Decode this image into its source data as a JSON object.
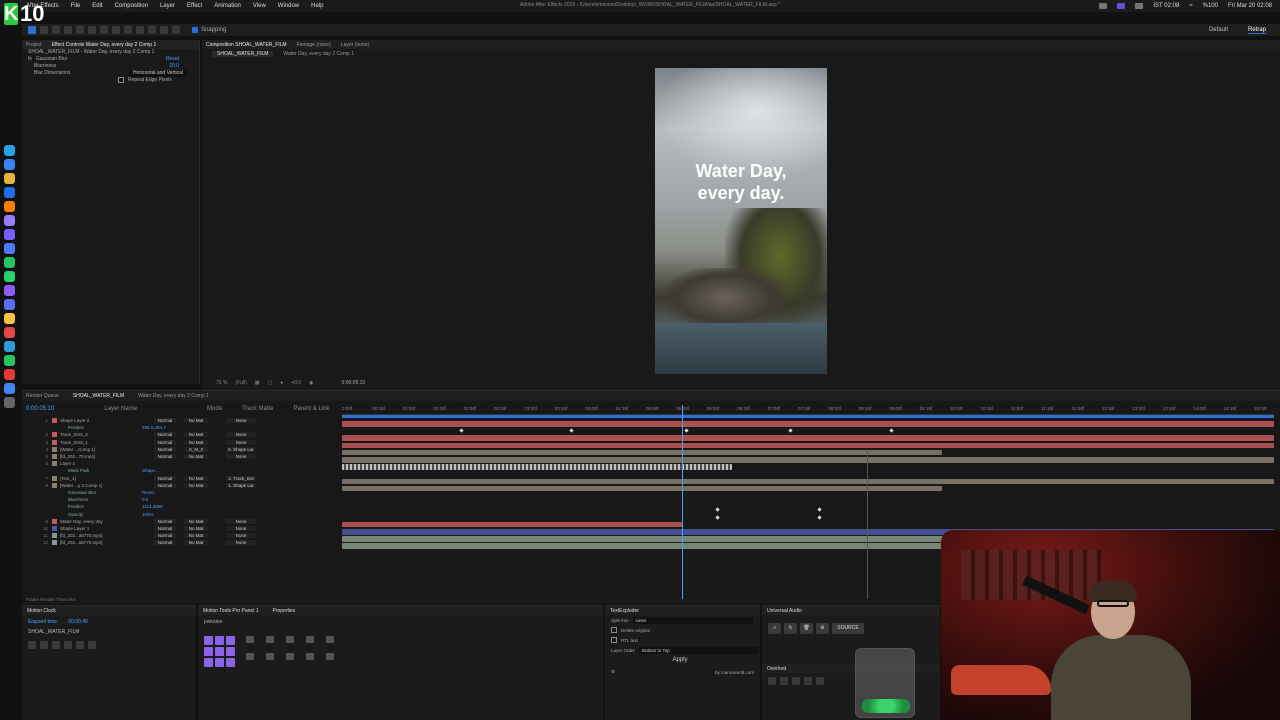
{
  "menubar": {
    "menus": [
      "After Effects",
      "File",
      "Edit",
      "Composition",
      "Layer",
      "Effect",
      "Animation",
      "View",
      "Window",
      "Help"
    ],
    "app_title": "Adobe After Effects 2026 - /Users/emerson/Desktop/_WORK/SHOAL_WATER_FILM/ae/SHOAL_WATER_FILM.aep *",
    "clock": "IST 02:08",
    "wifi": "%100",
    "date": "Fri Mar 20 02:08"
  },
  "logo": {
    "letter": "K",
    "number": "10"
  },
  "toolbar": {
    "snapping": "Snapping",
    "workspaces": [
      "Default",
      "Retrap"
    ]
  },
  "left_panel": {
    "tabs": [
      "Project",
      "Effect Controls Water Day, every day 2 Comp 1"
    ],
    "comp_label": "SHOAL_WATER_FILM - Water Day, every day 2 Comp 1",
    "effect_name": "Gaussian Blur",
    "effect_reset": "Reset",
    "rows": [
      {
        "label": "Blurriness",
        "value": "20.0"
      },
      {
        "label": "Blur Dimensions",
        "value": "Horizontal and Vertical"
      },
      {
        "label": "Repeat Edge Pixels",
        "value": ""
      }
    ]
  },
  "viewer": {
    "tabs": [
      "Composition SHOAL_WATER_FILM",
      "Footage (none)",
      "Layer (none)"
    ],
    "crumbs": [
      "SHOAL_WATER_FILM",
      "Water Day, every day 2 Comp 1"
    ],
    "title_line1": "Water Day,",
    "title_line2": "every day.",
    "zoom": "75 %",
    "resolution": "(Full)",
    "timecode": "0:00:05:10",
    "exposure": "+0.0"
  },
  "timeline": {
    "tabs": [
      "Render Queue",
      "SHOAL_WATER_FILM",
      "Water Day, every day 2 Comp 1"
    ],
    "timecode": "0:00:05:10",
    "col_headers": [
      "Layer Name",
      "Mode",
      "Track Matte",
      "Parent & Link"
    ],
    "ruler": [
      "0:00f",
      "00:15f",
      "01:00f",
      "01:15f",
      "02:00f",
      "02:15f",
      "03:00f",
      "03:15f",
      "04:00f",
      "04:15f",
      "05:00f",
      "05:15f",
      "06:00f",
      "06:15f",
      "07:00f",
      "07:15f",
      "08:00f",
      "08:15f",
      "09:00f",
      "09:15f",
      "10:00f",
      "10:15f",
      "11:00f",
      "11:15f",
      "12:00f",
      "12:15f",
      "13:00f",
      "13:15f",
      "14:00f",
      "14:15f",
      "15:00f"
    ],
    "layers": [
      {
        "idx": "1",
        "name": "Shape Layer 2",
        "mode": "Normal",
        "matte": "No Mat",
        "parent": "None",
        "color": "#c45a5a",
        "sub": false
      },
      {
        "idx": "",
        "name": "Position",
        "value": "288.0,484.7",
        "sub": true
      },
      {
        "idx": "2",
        "name": "Track_Dots_2",
        "mode": "Normal",
        "matte": "No Mat",
        "parent": "None",
        "color": "#c45a5a",
        "sub": false
      },
      {
        "idx": "3",
        "name": "Track_Dots_1",
        "mode": "Normal",
        "matte": "No Mat",
        "parent": "None",
        "color": "#c45a5a",
        "sub": false
      },
      {
        "idx": "4",
        "name": "[Water ...Comp 1]",
        "mode": "Normal",
        "matte": "S_M_2",
        "parent": "5. Shape Lar",
        "color": "#8a8070",
        "sub": false
      },
      {
        "idx": "5",
        "name": "[fd_202...70.mp4]",
        "mode": "Normal",
        "matte": "No Mat",
        "parent": "None",
        "color": "#8a8070",
        "sub": false
      },
      {
        "idx": "6",
        "name": "Layer 1",
        "mode": "",
        "matte": "",
        "parent": "",
        "color": "#8a8070",
        "sub": false
      },
      {
        "idx": "",
        "name": "Mask Path",
        "value": "Shape...",
        "sub": true
      },
      {
        "idx": "7",
        "name": "[Text_1]",
        "mode": "Normal",
        "matte": "No Mat",
        "parent": "2. Track_Dot",
        "color": "#8a8070",
        "sub": false
      },
      {
        "idx": "8",
        "name": "[Water ...y 2 Comp 1]",
        "mode": "Normal",
        "matte": "No Mat",
        "parent": "1. Shape Lar",
        "color": "#8a8070",
        "sub": false
      },
      {
        "idx": "",
        "name": "Gaussian Blur",
        "value": "Reset",
        "sub": true
      },
      {
        "idx": "",
        "name": "Blurriness",
        "value": "0.0",
        "sub": true
      },
      {
        "idx": "",
        "name": "Position",
        "value": "1114,4068",
        "sub": true
      },
      {
        "idx": "",
        "name": "Opacity",
        "value": "100%",
        "sub": true
      },
      {
        "idx": "9",
        "name": "Water Day, every day",
        "mode": "Normal",
        "matte": "No Mat",
        "parent": "None",
        "color": "#c45a5a",
        "sub": false
      },
      {
        "idx": "10",
        "name": "Shape Layer 1",
        "mode": "Normal",
        "matte": "No Mat",
        "parent": "None",
        "color": "#4a5aa8",
        "sub": false
      },
      {
        "idx": "11",
        "name": "[fd_202...a8770.mp4]",
        "mode": "Normal",
        "matte": "No Mat",
        "parent": "None",
        "color": "#8a9a8a",
        "sub": false
      },
      {
        "idx": "12",
        "name": "[fd_202...a8770.mp4]",
        "mode": "Normal",
        "matte": "No Mat",
        "parent": "None",
        "color": "#8a9a8a",
        "sub": false
      }
    ],
    "frame_render_time": "Frame Render Time 0ms"
  },
  "motion_clock": {
    "title": "Motion Clock",
    "elapsed_label": "Elapsed time",
    "elapsed_value": "00:00:40",
    "project": "SHOAL_WATER_FILM"
  },
  "motion_tools": {
    "tabs": [
      "Motion Tools Pro Panel 1",
      "Properties"
    ],
    "preset": "pwkalee"
  },
  "text_explodr": {
    "title": "TextExploder",
    "split_label": "Split Into",
    "split_value": "Lines",
    "delete_original": "Delete original",
    "rtl": "RTL text",
    "order_label": "Layer Order",
    "order_value": "Bottom to Top",
    "apply": "Apply",
    "credit": "by mamoworld.com"
  },
  "universal_audio": {
    "title": "Universal Audio",
    "source": "SOURCE"
  },
  "overlord": {
    "title": "Overlord"
  }
}
